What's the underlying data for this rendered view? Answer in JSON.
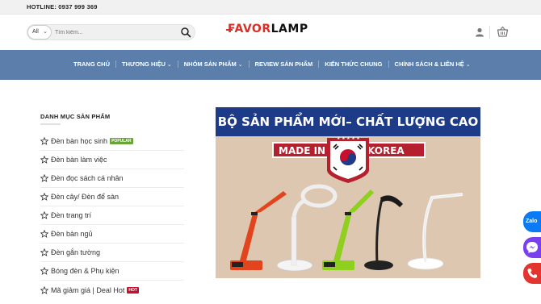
{
  "topbar": {
    "hotline": "HOTLINE: 0937 999 369"
  },
  "header": {
    "search": {
      "category": "All",
      "placeholder": "Tìm kiếm..."
    },
    "logo": {
      "part1": "FAVOR",
      "part2": "LAMP"
    }
  },
  "nav": {
    "items": [
      {
        "label": "TRANG CHỦ",
        "dropdown": false
      },
      {
        "label": "THƯƠNG HIỆU",
        "dropdown": true
      },
      {
        "label": "NHÓM SẢN PHẨM",
        "dropdown": true
      },
      {
        "label": "REVIEW SẢN PHẨM",
        "dropdown": false
      },
      {
        "label": "KIẾN THỨC CHUNG",
        "dropdown": false
      },
      {
        "label": "CHÍNH SÁCH & LIÊN HỆ",
        "dropdown": true
      }
    ]
  },
  "sidebar": {
    "title": "DANH MỤC SẢN PHẨM",
    "items": [
      {
        "label": "Đèn bàn học sinh",
        "badge": "POPULAR"
      },
      {
        "label": "Đèn bàn làm việc"
      },
      {
        "label": "Đèn đọc sách cá nhân"
      },
      {
        "label": "Đèn cây/ Đèn để sàn"
      },
      {
        "label": "Đèn trang trí"
      },
      {
        "label": "Đèn bàn ngủ"
      },
      {
        "label": "Đèn gắn tường"
      },
      {
        "label": "Bóng đèn & Phụ kiện"
      },
      {
        "label": "Mã giảm giá | Deal Hot",
        "badge": "HOT"
      }
    ]
  },
  "banner": {
    "headline": "BỘ SẢN PHẨM MỚI– CHẤT LƯỢNG CAO",
    "made_in": "MADE IN",
    "country": "KOREA"
  },
  "floating": {
    "zalo": "Zalo"
  },
  "colors": {
    "nav_bg": "#5b7eab",
    "banner_head": "#1d3b86",
    "accent": "#d63027",
    "popular_badge": "#6aa33a",
    "hot_badge": "#c8102e"
  }
}
